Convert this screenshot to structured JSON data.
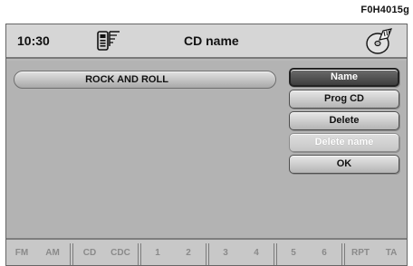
{
  "figure_code": "F0H4015g",
  "header": {
    "time": "10:30",
    "title": "CD name",
    "phone_icon": "phone-signal-icon",
    "cd_icon": "cd-disc-icon"
  },
  "name_field": {
    "value": "ROCK AND ROLL"
  },
  "menu": {
    "items": [
      {
        "label": "Name",
        "state": "selected"
      },
      {
        "label": "Prog CD",
        "state": "enabled"
      },
      {
        "label": "Delete",
        "state": "enabled"
      },
      {
        "label": "Delete name",
        "state": "disabled"
      },
      {
        "label": "OK",
        "state": "enabled"
      }
    ]
  },
  "softkeys": [
    "FM",
    "AM",
    "CD",
    "CDC",
    "1",
    "2",
    "3",
    "4",
    "5",
    "6",
    "RPT",
    "TA"
  ],
  "colors": {
    "screen_bg": "#b3b3b3",
    "selected_button": "#4e4e4e",
    "softkey_text": "#8a8a8a"
  }
}
